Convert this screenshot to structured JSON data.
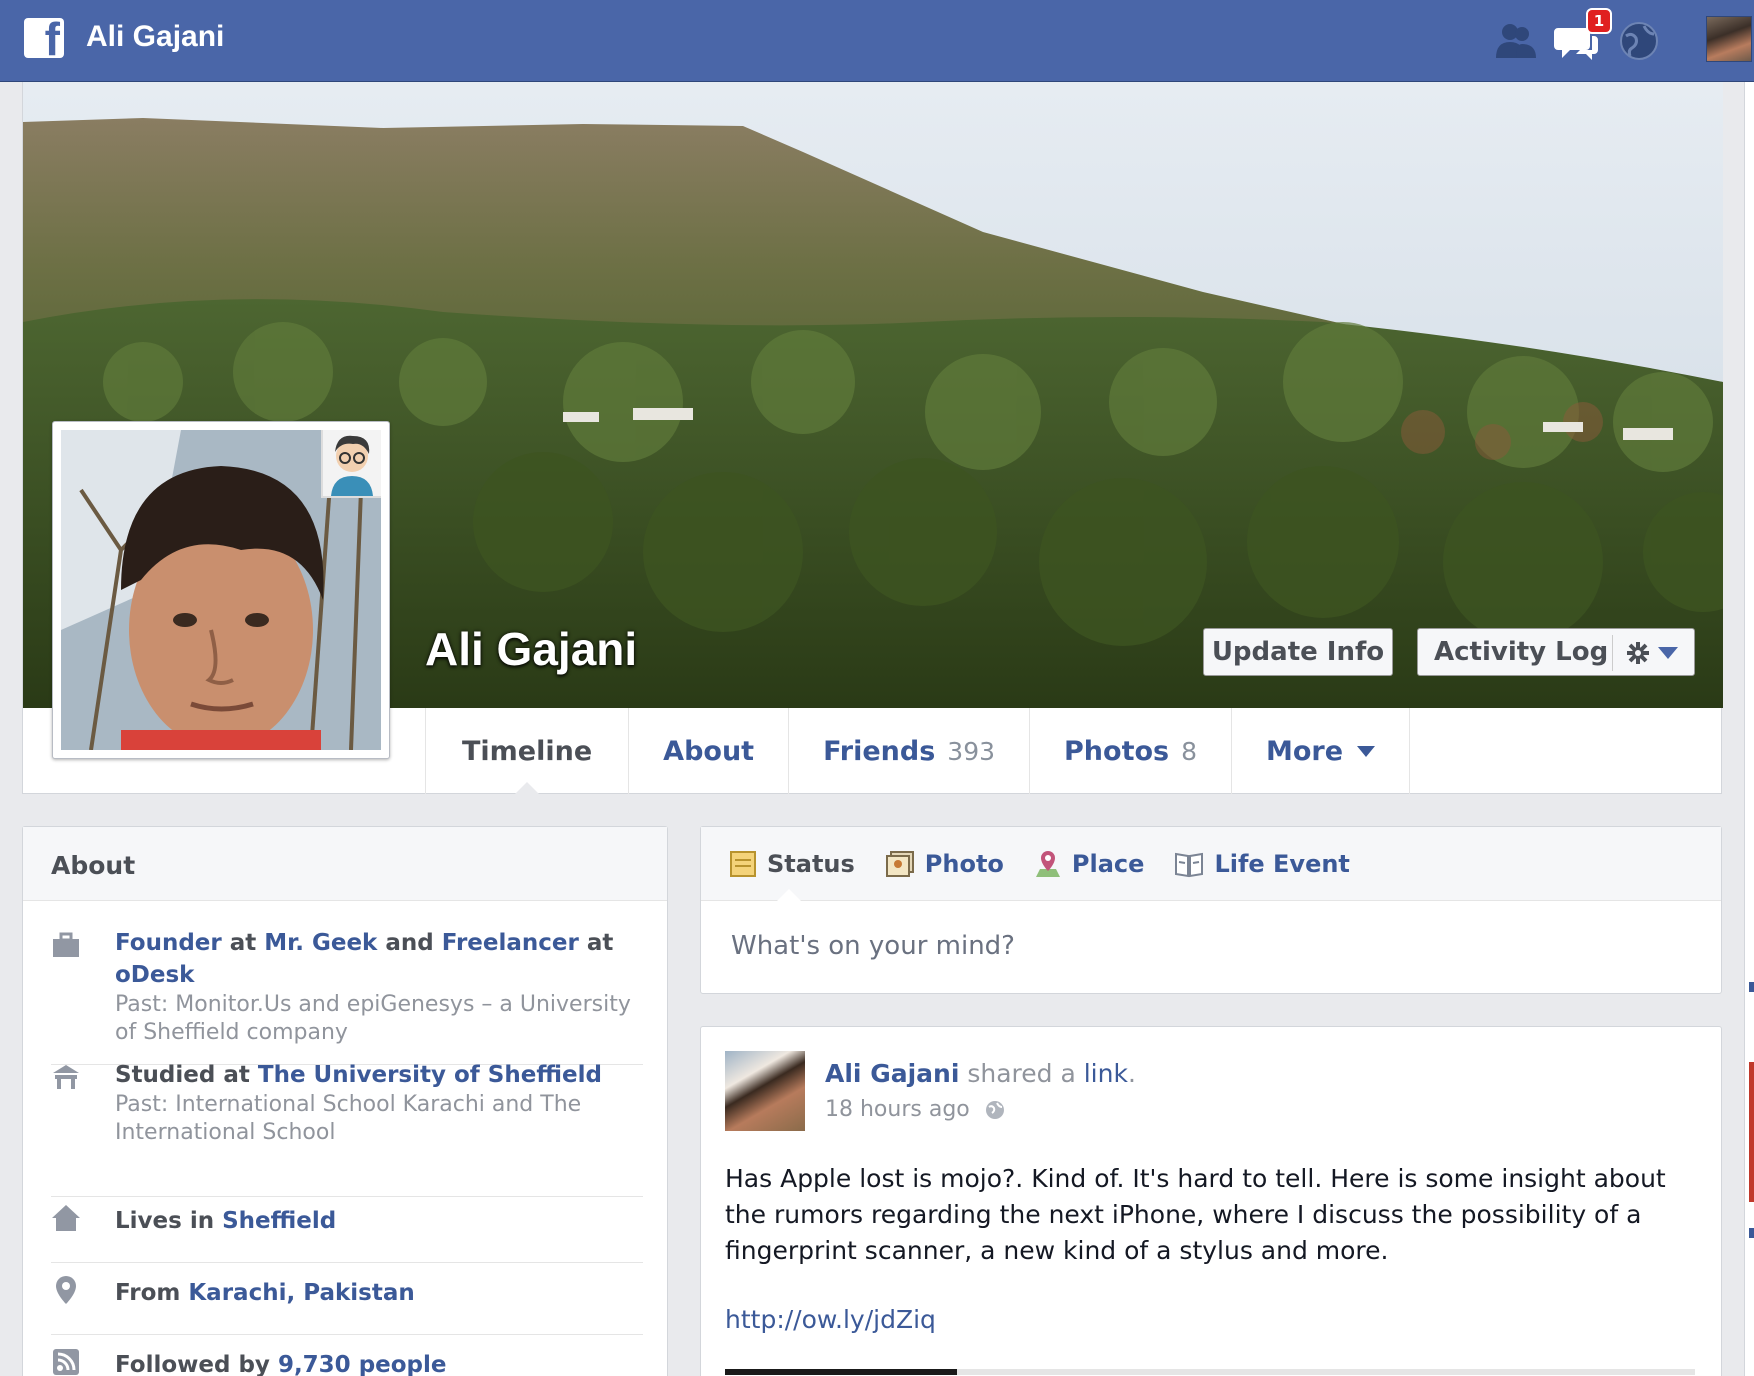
{
  "topbar": {
    "user_name": "Ali Gajani",
    "notification_count": "1",
    "icons": [
      "friends-icon",
      "messages-icon",
      "globe-icon"
    ]
  },
  "profile": {
    "name": "Ali Gajani",
    "buttons": {
      "update_info": "Update Info",
      "activity_log": "Activity Log"
    },
    "tabs": [
      {
        "label": "Timeline",
        "count": ""
      },
      {
        "label": "About",
        "count": ""
      },
      {
        "label": "Friends",
        "count": "393"
      },
      {
        "label": "Photos",
        "count": "8"
      },
      {
        "label": "More",
        "count": ""
      }
    ]
  },
  "about": {
    "heading": "About",
    "work": {
      "role1": "Founder",
      "at1": " at ",
      "org1": "Mr. Geek",
      "and": " and ",
      "role2": "Freelancer",
      "at2": " at ",
      "org2": "oDesk",
      "past": "Past: Monitor.Us and epiGenesys – a University of Sheffield company"
    },
    "education": {
      "prefix": "Studied at ",
      "school": "The University of Sheffield",
      "past": "Past: International School Karachi and The International School"
    },
    "lives": {
      "prefix": "Lives in ",
      "place": "Sheffield"
    },
    "from": {
      "prefix": "From ",
      "place": "Karachi, Pakistan"
    },
    "followed": {
      "prefix": "Followed by ",
      "count": "9,730 people"
    }
  },
  "composer": {
    "tabs": [
      "Status",
      "Photo",
      "Place",
      "Life Event"
    ],
    "placeholder": "What's on your mind?"
  },
  "post": {
    "author": "Ali Gajani",
    "action": " shared a ",
    "action_link": "link",
    "action_end": ".",
    "time": "18 hours ago",
    "text": "Has Apple lost is mojo?. Kind of. It's hard to tell. Here is some insight about the rumors regarding the next iPhone, where I discuss the possibility of a fingerprint scanner, a new kind of a stylus and more.",
    "url": "http://ow.ly/jdZiq"
  }
}
